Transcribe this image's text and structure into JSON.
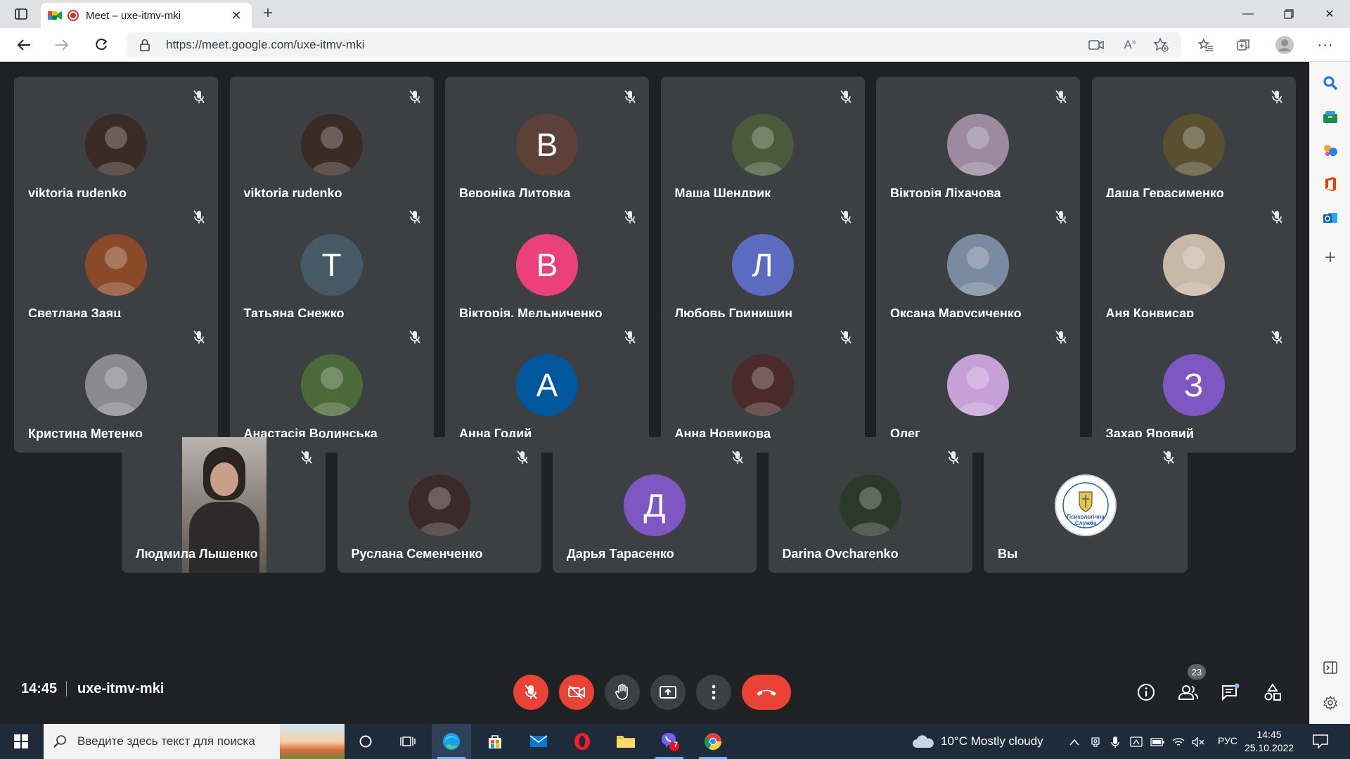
{
  "browser": {
    "tab_title": "Meet – uxe-itmv-mki",
    "url": "https://meet.google.com/uxe-itmv-mki"
  },
  "meet": {
    "participants": [
      {
        "name": "viktoria rudenko",
        "initial": "",
        "color": "#3a2a24"
      },
      {
        "name": "viktoria rudenko",
        "initial": "",
        "color": "#3a2a24"
      },
      {
        "name": "Вероніка Литовка",
        "initial": "В",
        "color": "#5d4037"
      },
      {
        "name": "Маша Шендрик",
        "initial": "",
        "color": "#4a5a3a"
      },
      {
        "name": "Вікторія Ліхачова",
        "initial": "",
        "color": "#9b8aa0"
      },
      {
        "name": "Даша Герасименко",
        "initial": "",
        "color": "#5a5030"
      },
      {
        "name": "Светлана Заяц",
        "initial": "",
        "color": "#8a4a2a"
      },
      {
        "name": "Татьяна Снежко",
        "initial": "Т",
        "color": "#455a64"
      },
      {
        "name": "Вікторія. Мельниченко",
        "initial": "В",
        "color": "#ec407a"
      },
      {
        "name": "Любовь Гринишин",
        "initial": "Л",
        "color": "#5c6bc0"
      },
      {
        "name": "Оксана Марусиченко",
        "initial": "",
        "color": "#7a8aa0"
      },
      {
        "name": "Аня Конвисар",
        "initial": "",
        "color": "#c8b8a8"
      },
      {
        "name": "Кристина Метенко",
        "initial": "",
        "color": "#8a8a90"
      },
      {
        "name": "Анастасія Волинська",
        "initial": "",
        "color": "#4a6a3a"
      },
      {
        "name": "Анна Годий",
        "initial": "А",
        "color": "#01579b"
      },
      {
        "name": "Анна Новикова",
        "initial": "",
        "color": "#4a2a2a"
      },
      {
        "name": "Олег",
        "initial": "",
        "color": "#c8a0d8"
      },
      {
        "name": "Захар Яровий",
        "initial": "З",
        "color": "#7e57c2"
      },
      {
        "name": "Людмила Лышенко",
        "initial": "",
        "color": "#2b2522",
        "video": true
      },
      {
        "name": "Руслана Семенченко",
        "initial": "",
        "color": "#3a2a2a"
      },
      {
        "name": "Дарья Тарасенко",
        "initial": "Д",
        "color": "#7e57c2"
      },
      {
        "name": "Darina Ovcharenko",
        "initial": "",
        "color": "#2a3a2a"
      },
      {
        "name": "Вы",
        "initial": "",
        "color": "#ffffff",
        "logo": true
      }
    ],
    "self_logo_text": "Психологічна Служба",
    "time": "14:45",
    "meeting_code": "uxe-itmv-mki",
    "people_count": "23"
  },
  "taskbar": {
    "search_placeholder": "Введите здесь текст для поиска",
    "weather": "10°C  Mostly cloudy",
    "lang": "РУС",
    "time": "14:45",
    "date": "25.10.2022",
    "viber_badge": "7"
  },
  "colors": {
    "meet_bg": "#202124",
    "tile_bg": "#3c4043",
    "danger": "#ea4335"
  }
}
